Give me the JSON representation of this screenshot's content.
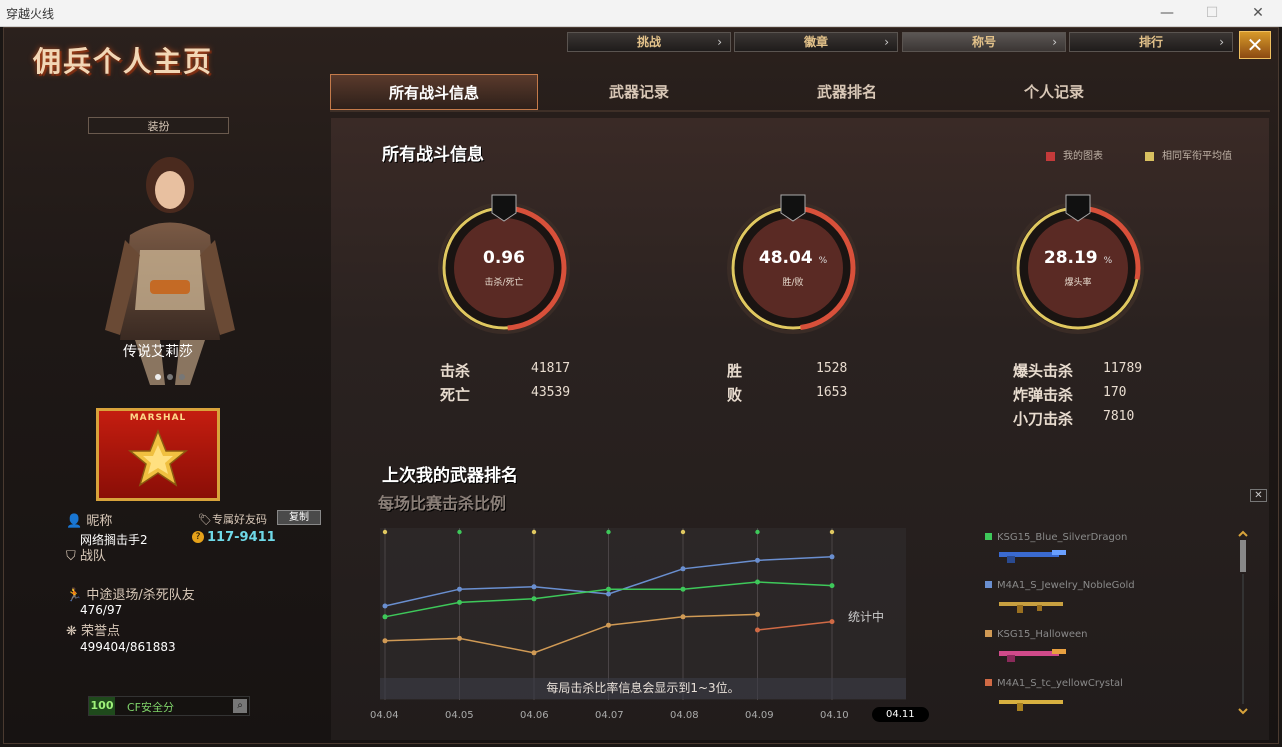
{
  "window": {
    "title": "穿越火线"
  },
  "page_title": "佣兵个人主页",
  "top_nav": [
    {
      "label": "挑战"
    },
    {
      "label": "徽章"
    },
    {
      "label": "称号"
    },
    {
      "label": "排行"
    }
  ],
  "tabs": [
    {
      "label": "所有战斗信息"
    },
    {
      "label": "武器记录"
    },
    {
      "label": "武器排名"
    },
    {
      "label": "个人记录"
    }
  ],
  "left": {
    "dress_button": "装扮",
    "character_name": "传说艾莉莎",
    "rank_badge": "MARSHAL",
    "nickname_label": "昵称",
    "nickname_value": "网络搁击手2",
    "friend_code_label": "专属好友码",
    "copy_button": "复制",
    "friend_code": "117-9411",
    "team_label": "战队",
    "quit_label": "中途退场/杀死队友",
    "quit_value": "476/97",
    "honor_label": "荣誉点",
    "honor_value": "499404/861883",
    "safety_score": "100",
    "safety_label": "CF安全分"
  },
  "main": {
    "title": "所有战斗信息",
    "legend_mine": "我的图表",
    "legend_avg": "相同军衔平均值",
    "gauges": [
      {
        "value": "0.96",
        "unit": "",
        "label": "击杀/死亡",
        "icon": "skull-icon",
        "fraction": 0.49
      },
      {
        "value": "48.04",
        "unit": "%",
        "label": "胜/败",
        "icon": "crossed-guns-icon",
        "fraction": 0.48
      },
      {
        "value": "28.19",
        "unit": "%",
        "label": "爆头率",
        "icon": "crosshair-icon",
        "fraction": 0.28
      }
    ],
    "stats_kd": [
      {
        "label": "击杀",
        "value": "41817"
      },
      {
        "label": "死亡",
        "value": "43539"
      }
    ],
    "stats_wl": [
      {
        "label": "胜",
        "value": "1528"
      },
      {
        "label": "败",
        "value": "1653"
      }
    ],
    "stats_hs": [
      {
        "label": "爆头击杀",
        "value": "11789"
      },
      {
        "label": "炸弹击杀",
        "value": "170"
      },
      {
        "label": "小刀击杀",
        "value": "7810"
      }
    ],
    "weapon_section_title": "上次我的武器排名",
    "chart_subtitle": "每场比赛击杀比例",
    "chart_caption": "每局击杀比率信息会显示到1~3位。",
    "chart_status": "统计中",
    "close_x": "✕",
    "weapons": [
      {
        "name": "KSG15_Blue_SilverDragon",
        "color": "#3ec85a"
      },
      {
        "name": "M4A1_S_Jewelry_NobleGold",
        "color": "#6a8fd0"
      },
      {
        "name": "KSG15_Halloween",
        "color": "#d09a55"
      },
      {
        "name": "M4A1_S_tc_yellowCrystal",
        "color": "#d06a45"
      }
    ]
  },
  "chart_data": {
    "type": "line",
    "x": [
      "04.04",
      "04.05",
      "04.06",
      "04.07",
      "04.08",
      "04.09",
      "04.10",
      "04.11"
    ],
    "active_x": "04.11",
    "ylim": [
      0,
      100
    ],
    "series": [
      {
        "values": [
          60,
          74,
          76,
          70,
          91,
          98,
          101,
          null
        ],
        "color": "#6a8fd0"
      },
      {
        "values": [
          51,
          63,
          66,
          74,
          74,
          80,
          77,
          null
        ],
        "color": "#3ec85a"
      },
      {
        "values": [
          31,
          33,
          21,
          44,
          51,
          53,
          null,
          null
        ],
        "color": "#d09a55"
      },
      {
        "values": [
          null,
          null,
          null,
          null,
          null,
          40,
          47,
          null
        ],
        "color": "#d06a45"
      }
    ]
  }
}
